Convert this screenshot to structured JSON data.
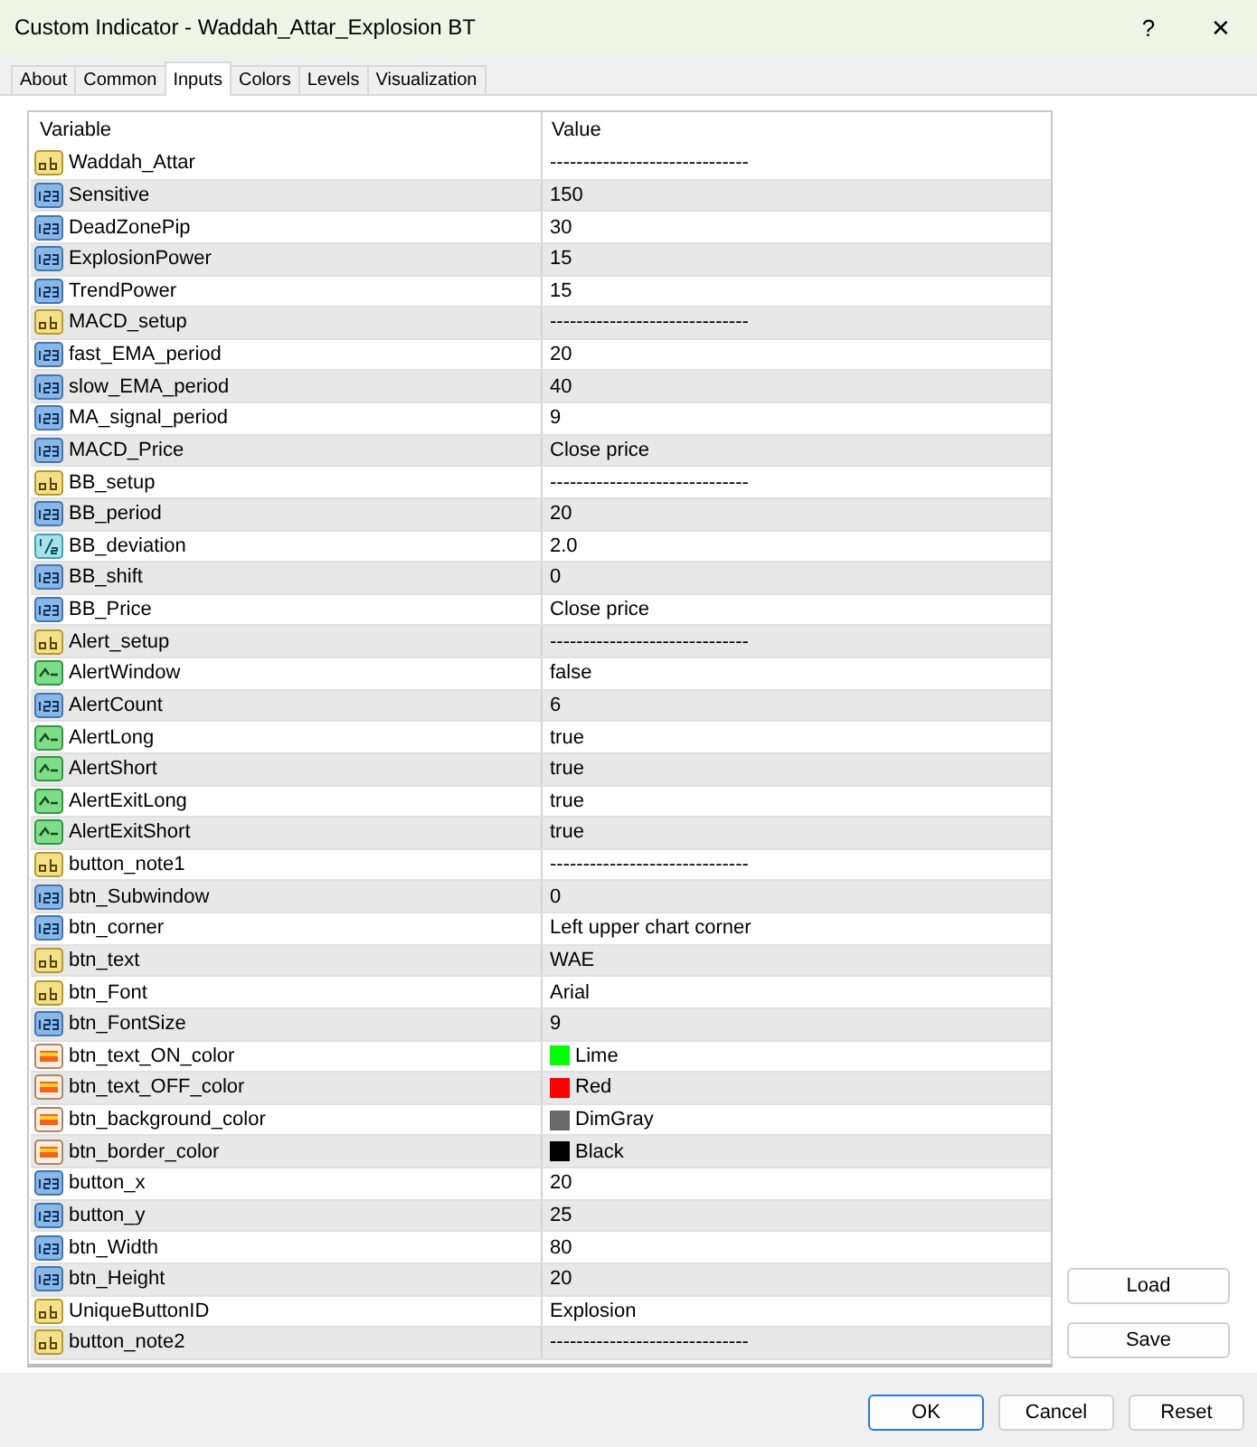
{
  "window": {
    "title": "Custom Indicator - Waddah_Attar_Explosion BT",
    "help": "?",
    "close": "✕"
  },
  "tabs": [
    {
      "label": "About",
      "selected": false
    },
    {
      "label": "Common",
      "selected": false
    },
    {
      "label": "Inputs",
      "selected": true
    },
    {
      "label": "Colors",
      "selected": false
    },
    {
      "label": "Levels",
      "selected": false
    },
    {
      "label": "Visualization",
      "selected": false
    }
  ],
  "table": {
    "columns": [
      "Variable",
      "Value"
    ],
    "rows": [
      {
        "kind": "string",
        "variable": "Waddah_Attar",
        "value": "------------------------------"
      },
      {
        "kind": "int",
        "variable": "Sensitive",
        "value": "150"
      },
      {
        "kind": "int",
        "variable": "DeadZonePip",
        "value": "30"
      },
      {
        "kind": "int",
        "variable": "ExplosionPower",
        "value": "15"
      },
      {
        "kind": "int",
        "variable": "TrendPower",
        "value": "15"
      },
      {
        "kind": "string",
        "variable": "MACD_setup",
        "value": "------------------------------"
      },
      {
        "kind": "int",
        "variable": "fast_EMA_period",
        "value": "20"
      },
      {
        "kind": "int",
        "variable": "slow_EMA_period",
        "value": "40"
      },
      {
        "kind": "int",
        "variable": "MA_signal_period",
        "value": "9"
      },
      {
        "kind": "int",
        "variable": "MACD_Price",
        "value": "Close price"
      },
      {
        "kind": "string",
        "variable": "BB_setup",
        "value": "------------------------------"
      },
      {
        "kind": "int",
        "variable": "BB_period",
        "value": "20"
      },
      {
        "kind": "double",
        "variable": "BB_deviation",
        "value": "2.0"
      },
      {
        "kind": "int",
        "variable": "BB_shift",
        "value": "0"
      },
      {
        "kind": "int",
        "variable": "BB_Price",
        "value": "Close price"
      },
      {
        "kind": "string",
        "variable": "Alert_setup",
        "value": "------------------------------"
      },
      {
        "kind": "bool",
        "variable": "AlertWindow",
        "value": "false"
      },
      {
        "kind": "int",
        "variable": "AlertCount",
        "value": "6"
      },
      {
        "kind": "bool",
        "variable": "AlertLong",
        "value": "true"
      },
      {
        "kind": "bool",
        "variable": "AlertShort",
        "value": "true"
      },
      {
        "kind": "bool",
        "variable": "AlertExitLong",
        "value": "true"
      },
      {
        "kind": "bool",
        "variable": "AlertExitShort",
        "value": "true"
      },
      {
        "kind": "string",
        "variable": "button_note1",
        "value": "------------------------------"
      },
      {
        "kind": "int",
        "variable": "btn_Subwindow",
        "value": "0"
      },
      {
        "kind": "int",
        "variable": "btn_corner",
        "value": "Left upper chart corner"
      },
      {
        "kind": "string",
        "variable": "btn_text",
        "value": "WAE"
      },
      {
        "kind": "string",
        "variable": "btn_Font",
        "value": "Arial"
      },
      {
        "kind": "int",
        "variable": "btn_FontSize",
        "value": "9"
      },
      {
        "kind": "color",
        "variable": "btn_text_ON_color",
        "value": "Lime",
        "color": "#00ff00"
      },
      {
        "kind": "color",
        "variable": "btn_text_OFF_color",
        "value": "Red",
        "color": "#ff0000"
      },
      {
        "kind": "color",
        "variable": "btn_background_color",
        "value": "DimGray",
        "color": "#696969"
      },
      {
        "kind": "color",
        "variable": "btn_border_color",
        "value": "Black",
        "color": "#000000"
      },
      {
        "kind": "int",
        "variable": "button_x",
        "value": "20"
      },
      {
        "kind": "int",
        "variable": "button_y",
        "value": "25"
      },
      {
        "kind": "int",
        "variable": "btn_Width",
        "value": "80"
      },
      {
        "kind": "int",
        "variable": "btn_Height",
        "value": "20"
      },
      {
        "kind": "string",
        "variable": "UniqueButtonID",
        "value": "Explosion"
      },
      {
        "kind": "string",
        "variable": "button_note2",
        "value": "------------------------------"
      }
    ]
  },
  "side_buttons": [
    "Load",
    "Save"
  ],
  "buttons": [
    {
      "label": "OK",
      "default": true
    },
    {
      "label": "Cancel",
      "default": false
    },
    {
      "label": "Reset",
      "default": false
    }
  ]
}
